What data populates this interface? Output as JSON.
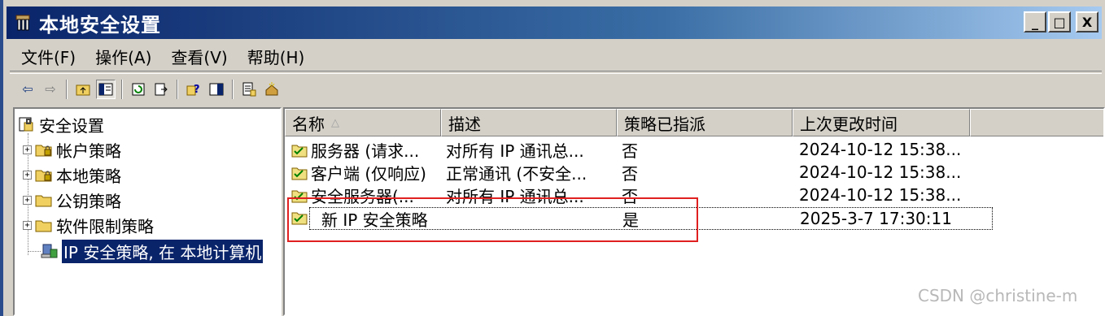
{
  "window": {
    "title": "本地安全设置"
  },
  "title_buttons": {
    "minimize": "_",
    "maximize": "□",
    "close": "X"
  },
  "menu": [
    "文件(F)",
    "操作(A)",
    "查看(V)",
    "帮助(H)"
  ],
  "toolbar": {
    "back": "⇦",
    "forward": "⇨"
  },
  "tree": {
    "root": "安全设置",
    "items": [
      {
        "label": "帐户策略",
        "expander": "+"
      },
      {
        "label": "本地策略",
        "expander": "+"
      },
      {
        "label": "公钥策略",
        "expander": "+"
      },
      {
        "label": "软件限制策略",
        "expander": "+"
      },
      {
        "label": "IP 安全策略, 在 本地计算机"
      }
    ]
  },
  "list": {
    "columns": [
      "名称",
      "描述",
      "策略已指派",
      "上次更改时间"
    ],
    "sort_indicator": "△",
    "rows": [
      {
        "name": "服务器 (请求...",
        "desc": "对所有 IP 通讯总...",
        "assigned": "否",
        "time": "2024-10-12 15:38..."
      },
      {
        "name": "客户端 (仅响应)",
        "desc": "正常通讯 (不安全...",
        "assigned": "否",
        "time": "2024-10-12 15:38..."
      },
      {
        "name": "安全服务器(...",
        "desc": "对所有 IP 通讯总...",
        "assigned": "否",
        "time": "2024-10-12 15:38..."
      },
      {
        "name": "新 IP 安全策略",
        "desc": "",
        "assigned": "是",
        "time": "2025-3-7 17:30:11"
      }
    ]
  },
  "watermark": "CSDN @christine-m",
  "colors": {
    "titlebar_start": "#0a246a",
    "titlebar_end": "#a6caf0",
    "highlight": "#e02020"
  }
}
